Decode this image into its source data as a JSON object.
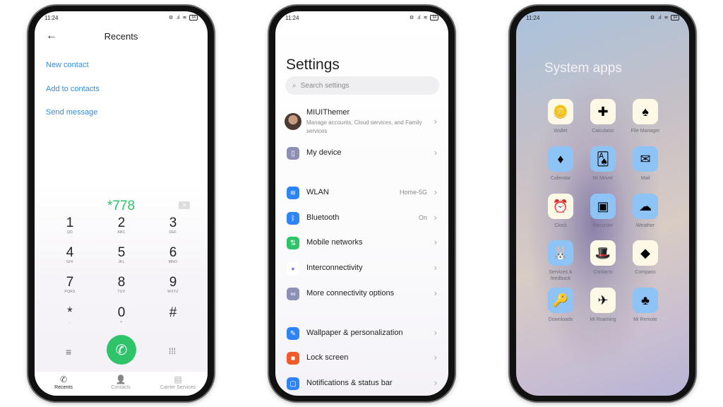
{
  "status": {
    "time": "11:24",
    "battery": "94"
  },
  "dialer": {
    "title": "Recents",
    "actions": [
      "New contact",
      "Add to contacts",
      "Send message"
    ],
    "number": "*778",
    "keys": [
      {
        "d": "1",
        "l": "QD"
      },
      {
        "d": "2",
        "l": "ABC"
      },
      {
        "d": "3",
        "l": "DEF"
      },
      {
        "d": "4",
        "l": "GHI"
      },
      {
        "d": "5",
        "l": "JKL"
      },
      {
        "d": "6",
        "l": "MNO"
      },
      {
        "d": "7",
        "l": "PQRS"
      },
      {
        "d": "8",
        "l": "TUV"
      },
      {
        "d": "9",
        "l": "WXYZ"
      },
      {
        "d": "*",
        "l": ","
      },
      {
        "d": "0",
        "l": "+"
      },
      {
        "d": "#",
        "l": ""
      }
    ],
    "tabs": [
      {
        "label": "Recents",
        "icon": "phone-icon",
        "active": true
      },
      {
        "label": "Contacts",
        "icon": "person-icon",
        "active": false
      },
      {
        "label": "Carrier Services",
        "icon": "store-icon",
        "active": false
      }
    ],
    "accent": "#2fc46a"
  },
  "settings": {
    "title": "Settings",
    "search_placeholder": "Search settings",
    "account": {
      "name": "MIUIThemer",
      "sub": "Manage accounts, Cloud services, and Family services"
    },
    "items": [
      {
        "label": "My device",
        "value": "",
        "icon": "device-icon",
        "color": "#8e8fb5",
        "glyph": "▯"
      },
      {
        "label": "WLAN",
        "value": "Home-5G",
        "icon": "wifi-icon",
        "color": "#2f84f5",
        "glyph": "≋"
      },
      {
        "label": "Bluetooth",
        "value": "On",
        "icon": "bluetooth-icon",
        "color": "#2f84f5",
        "glyph": "ᛒ"
      },
      {
        "label": "Mobile networks",
        "value": "",
        "icon": "mobile-data-icon",
        "color": "#2fc46a",
        "glyph": "⇅"
      },
      {
        "label": "Interconnectivity",
        "value": "",
        "icon": "interconnect-icon",
        "color": "#ffffff",
        "glyph": "•"
      },
      {
        "label": "More connectivity options",
        "value": "",
        "icon": "link-icon",
        "color": "#8e8fb5",
        "glyph": "∞"
      },
      {
        "label": "Wallpaper & personalization",
        "value": "",
        "icon": "wallpaper-icon",
        "color": "#2f84f5",
        "glyph": "✎"
      },
      {
        "label": "Lock screen",
        "value": "",
        "icon": "lock-icon",
        "color": "#f25a2c",
        "glyph": "■"
      },
      {
        "label": "Notifications & status bar",
        "value": "",
        "icon": "notification-icon",
        "color": "#2f84f5",
        "glyph": "▢"
      }
    ]
  },
  "apps": {
    "title": "System apps",
    "items": [
      {
        "label": "Wallet",
        "icon": "wallet-icon",
        "bg": "#fdf9e6",
        "glyph": "🪙"
      },
      {
        "label": "Calculator",
        "icon": "calculator-icon",
        "bg": "#fdf9e6",
        "glyph": "✚"
      },
      {
        "label": "File Manager",
        "icon": "folder-icon",
        "bg": "#fdf9e6",
        "glyph": "♠"
      },
      {
        "label": "Calendar",
        "icon": "calendar-icon",
        "bg": "#8ec3f5",
        "glyph": "♦"
      },
      {
        "label": "Mi Mover",
        "icon": "mi-mover-icon",
        "bg": "#8ec3f5",
        "glyph": "🂡"
      },
      {
        "label": "Mail",
        "icon": "mail-icon",
        "bg": "#8ec3f5",
        "glyph": "✉"
      },
      {
        "label": "Clock",
        "icon": "clock-icon",
        "bg": "#fdf9e6",
        "glyph": "⏰"
      },
      {
        "label": "Recorder",
        "icon": "recorder-icon",
        "bg": "#8ec3f5",
        "glyph": "▣"
      },
      {
        "label": "Weather",
        "icon": "weather-icon",
        "bg": "#8ec3f5",
        "glyph": "☁"
      },
      {
        "label": "Services & feedback",
        "icon": "services-icon",
        "bg": "#8ec3f5",
        "glyph": "🐰"
      },
      {
        "label": "Contacts",
        "icon": "contacts-icon",
        "bg": "#fdf9e6",
        "glyph": "🎩"
      },
      {
        "label": "Compass",
        "icon": "compass-icon",
        "bg": "#fdf9e6",
        "glyph": "◆"
      },
      {
        "label": "Downloads",
        "icon": "downloads-icon",
        "bg": "#8ec3f5",
        "glyph": "🔑"
      },
      {
        "label": "Mi Roaming",
        "icon": "roaming-icon",
        "bg": "#fdf9e6",
        "glyph": "✈"
      },
      {
        "label": "Mi Remote",
        "icon": "remote-icon",
        "bg": "#8ec3f5",
        "glyph": "♣"
      }
    ]
  }
}
